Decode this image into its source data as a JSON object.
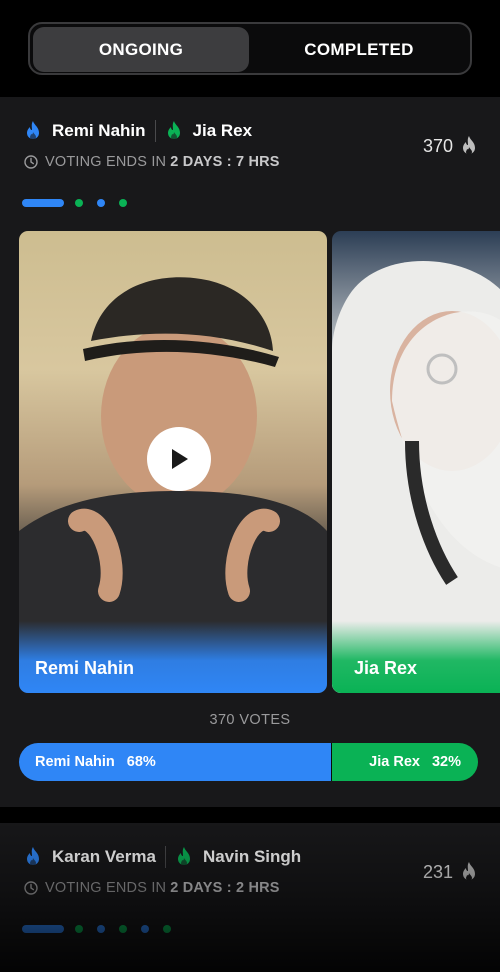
{
  "tabs": {
    "ongoing": "ONGOING",
    "completed": "COMPLETED"
  },
  "battles": [
    {
      "contestant_a": "Remi Nahin",
      "contestant_b": "Jia Rex",
      "ends_prefix": "VOTING ENDS IN",
      "ends_value": "2 DAYS : 7 HRS",
      "count": "370",
      "votes_label": "370 VOTES",
      "pct_a": "68%",
      "pct_b": "32%",
      "share_a": 0.68,
      "media_a_label": "Remi Nahin",
      "media_b_label": "Jia Rex"
    },
    {
      "contestant_a": "Karan Verma",
      "contestant_b": "Navin Singh",
      "ends_prefix": "VOTING ENDS IN",
      "ends_value": "2 DAYS : 2 HRS",
      "count": "231"
    }
  ],
  "colors": {
    "blue": "#2f86f6",
    "green": "#0ab255",
    "card": "#18181a"
  },
  "icons": {
    "team_a": "blue-flame-icon",
    "team_b": "green-flame-icon",
    "clock": "clock-icon",
    "count": "flame-icon",
    "play": "play-icon"
  }
}
